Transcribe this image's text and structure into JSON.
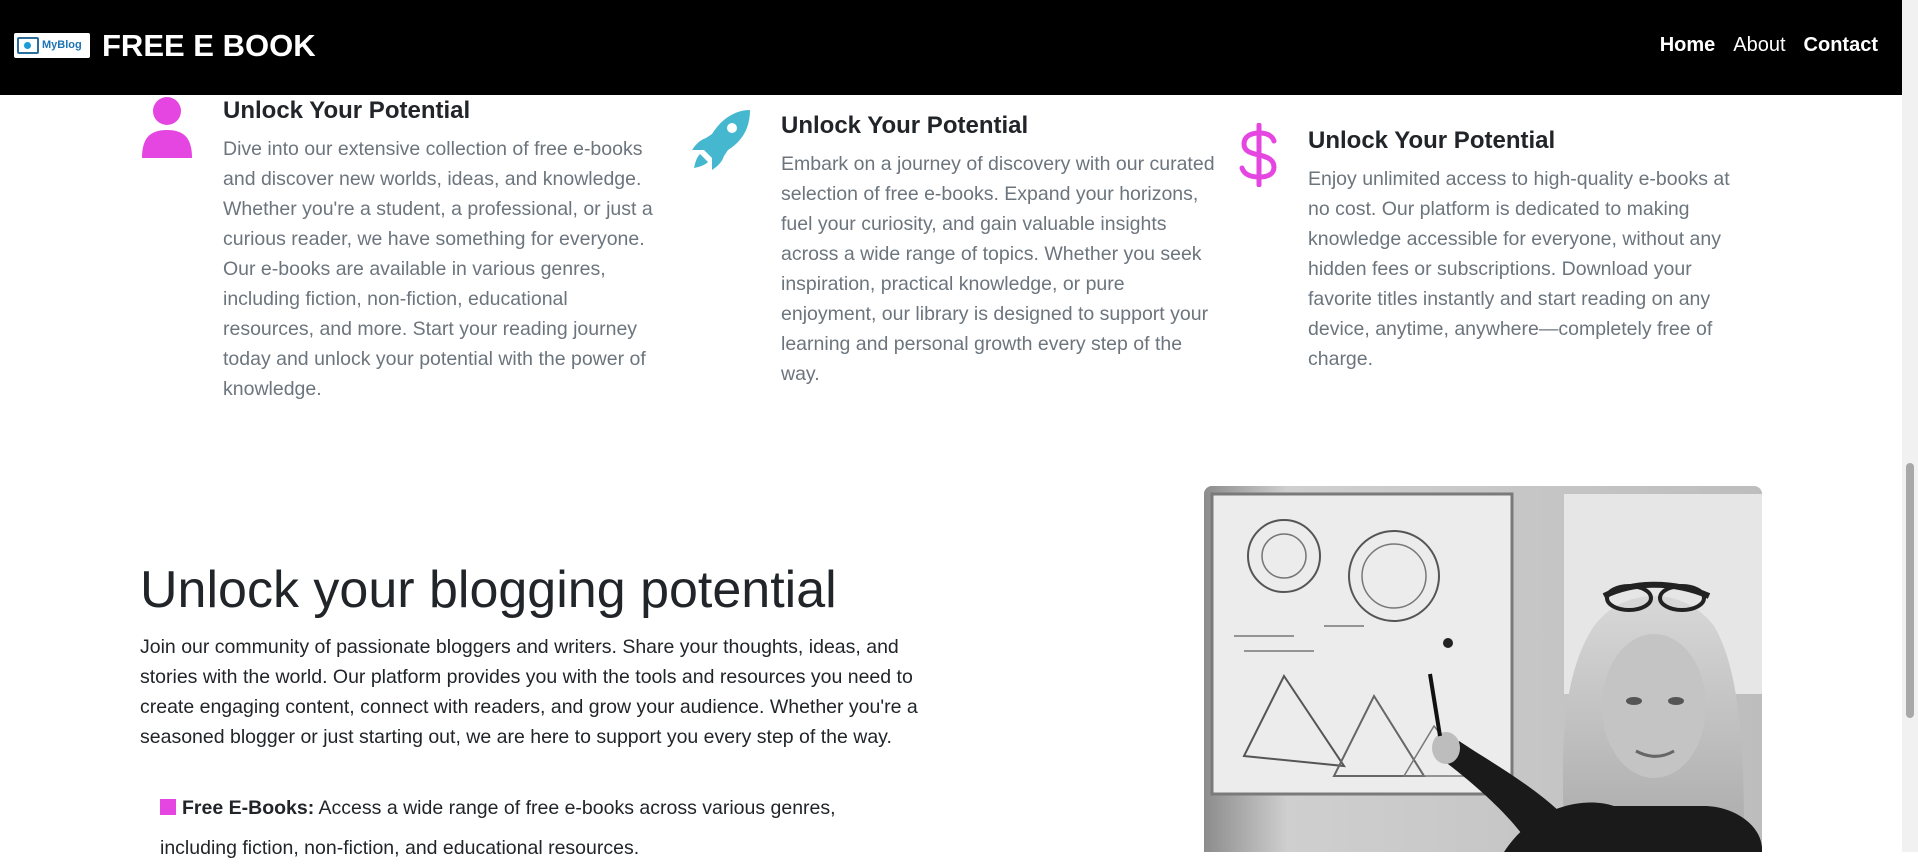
{
  "header": {
    "logo_text": "MyBlog",
    "title": "FREE E BOOK",
    "nav": [
      {
        "label": "Home"
      },
      {
        "label": "About"
      },
      {
        "label": "Contact"
      }
    ]
  },
  "features": [
    {
      "icon": "user-icon",
      "icon_color": "#e545e0",
      "title": "Unlock Your Potential",
      "text": "Dive into our extensive collection of free e-books and discover new worlds, ideas, and knowledge. Whether you're a student, a professional, or just a curious reader, we have something for everyone. Our e-books are available in various genres, including fiction, non-fiction, educational resources, and more. Start your reading journey today and unlock your potential with the power of knowledge."
    },
    {
      "icon": "rocket-icon",
      "icon_color": "#45b8d0",
      "title": "Unlock Your Potential",
      "text": "Embark on a journey of discovery with our curated selection of free e-books. Expand your horizons, fuel your curiosity, and gain valuable insights across a wide range of topics. Whether you seek inspiration, practical knowledge, or pure enjoyment, our library is designed to support your learning and personal growth every step of the way."
    },
    {
      "icon": "dollar-icon",
      "icon_color": "#e545e0",
      "title": "Unlock Your Potential",
      "text": "Enjoy unlimited access to high-quality e-books at no cost. Our platform is dedicated to making knowledge accessible for everyone, without any hidden fees or subscriptions. Download your favorite titles instantly and start reading on any device, anytime, anywhere—completely free of charge."
    }
  ],
  "blog": {
    "heading": "Unlock your blogging potential",
    "description": "Join our community of passionate bloggers and writers. Share your thoughts, ideas, and stories with the world. Our platform provides you with the tools and resources you need to create engaging content, connect with readers, and grow your audience. Whether you're a seasoned blogger or just starting out, we are here to support you every step of the way.",
    "list": [
      {
        "label": "Free E-Books:",
        "text": " Access a wide range of free e-books across various genres, including fiction, non-fiction, and educational resources."
      }
    ],
    "accent_color": "#e545e0"
  }
}
